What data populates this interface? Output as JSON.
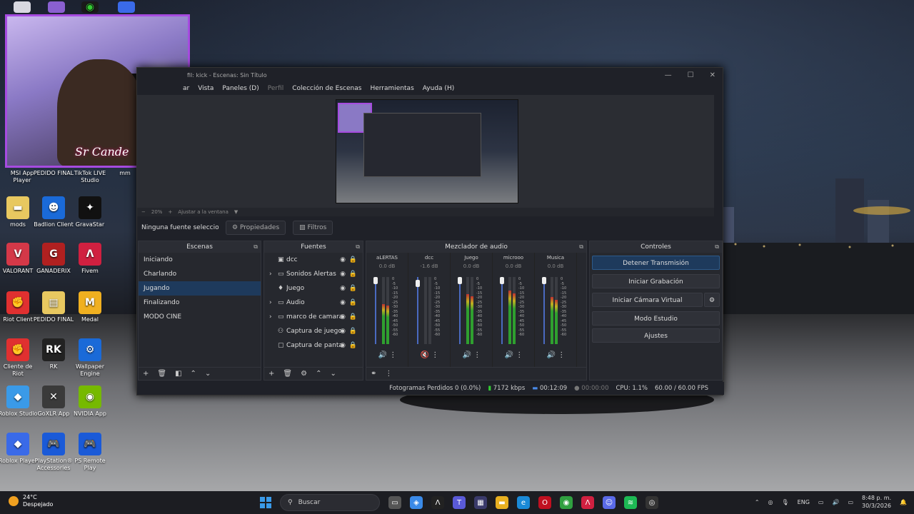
{
  "desktop_icons": [
    {
      "label": "MSI App Player",
      "color": "#2a6ad8",
      "glyph": "▶"
    },
    {
      "label": "PEDIDO FINAL",
      "color": "#e8c860",
      "glyph": "▤"
    },
    {
      "label": "TikTok LIVE Studio",
      "color": "#111111",
      "glyph": "♪"
    },
    {
      "label": "mm",
      "color": "#222222",
      "glyph": ""
    },
    {
      "label": "mods",
      "color": "#e8c860",
      "glyph": "▬"
    },
    {
      "label": "Badlion Client",
      "color": "#1a6ad8",
      "glyph": "☻"
    },
    {
      "label": "GravaStar",
      "color": "#111111",
      "glyph": "✦"
    },
    {
      "label": "VALORANT",
      "color": "#d43848",
      "glyph": "V"
    },
    {
      "label": "GANADERIX",
      "color": "#b02020",
      "glyph": "G"
    },
    {
      "label": "Fivem",
      "color": "#d02040",
      "glyph": "Λ"
    },
    {
      "label": "Riot Client",
      "color": "#e03030",
      "glyph": "✊"
    },
    {
      "label": "PEDIDO FINAL",
      "color": "#e8c860",
      "glyph": "▤"
    },
    {
      "label": "Medal",
      "color": "#f0b020",
      "glyph": "M"
    },
    {
      "label": "Cliente de Riot",
      "color": "#e03030",
      "glyph": "✊"
    },
    {
      "label": "RK",
      "color": "#222222",
      "glyph": "RK"
    },
    {
      "label": "Wallpaper Engine",
      "color": "#1a6ad8",
      "glyph": "⚙"
    },
    {
      "label": "Roblox Studio",
      "color": "#3a9ae8",
      "glyph": "◆"
    },
    {
      "label": "GoXLR App",
      "color": "#3a3a3a",
      "glyph": "✕"
    },
    {
      "label": "NVIDIA App",
      "color": "#76b900",
      "glyph": "◉"
    },
    {
      "label": "Roblox Player",
      "color": "#3a6ae8",
      "glyph": "◆"
    },
    {
      "label": "PlayStation® Accessories",
      "color": "#1a5ad8",
      "glyph": "🎮"
    },
    {
      "label": "PS Remote Play",
      "color": "#1a5ad8",
      "glyph": "🎮"
    }
  ],
  "webcam": {
    "overlay_text": "Sr Cande"
  },
  "obs": {
    "title": "fil: kick - Escenas: Sin Título",
    "menu": [
      "ar",
      "Vista",
      "Paneles (D)",
      "Perfil",
      "Colección de Escenas",
      "Herramientas",
      "Ayuda (H)"
    ],
    "zoom": {
      "minus": "−",
      "value": "20%",
      "plus": "+",
      "fit": "Ajustar a la ventana"
    },
    "no_source": "Ninguna fuente seleccionada",
    "properties_btn": "Propiedades",
    "filters_btn": "Filtros",
    "scenes": {
      "title": "Escenas",
      "items": [
        "Iniciando",
        "Charlando",
        "Jugando",
        "Finalizando",
        "MODO CINE"
      ],
      "selected": "Jugando"
    },
    "sources": {
      "title": "Fuentes",
      "items": [
        {
          "label": "dcc",
          "icon": "▣",
          "expand": ""
        },
        {
          "label": "Sonidos Alertas",
          "icon": "▭",
          "expand": "›"
        },
        {
          "label": "Juego",
          "icon": "♦",
          "expand": ""
        },
        {
          "label": "Audio",
          "icon": "▭",
          "expand": "›"
        },
        {
          "label": "marco de camara",
          "icon": "▭",
          "expand": "›"
        },
        {
          "label": "Captura de juego",
          "icon": "⚇",
          "expand": ""
        },
        {
          "label": "Captura de pantalla",
          "icon": "▢",
          "expand": ""
        }
      ]
    },
    "mixer": {
      "title": "Mezclador de audio",
      "channels": [
        {
          "name": "aLERTAS",
          "db": "0.0 dB",
          "level": 0.6,
          "fader": 1.0,
          "muted": false
        },
        {
          "name": "dcc",
          "db": "-1.6 dB",
          "level": 0.0,
          "fader": 0.95,
          "muted": true
        },
        {
          "name": "Juego",
          "db": "0.0 dB",
          "level": 0.75,
          "fader": 1.0,
          "muted": false
        },
        {
          "name": "microoo",
          "db": "0.0 dB",
          "level": 0.8,
          "fader": 1.0,
          "muted": false
        },
        {
          "name": "Musica",
          "db": "0.0 dB",
          "level": 0.7,
          "fader": 1.0,
          "muted": false
        }
      ],
      "scale": [
        "0",
        "-5",
        "-10",
        "-15",
        "-20",
        "-25",
        "-30",
        "-35",
        "-40",
        "-45",
        "-50",
        "-55",
        "-60"
      ]
    },
    "controls": {
      "title": "Controles",
      "stop_stream": "Detener Transmisión",
      "start_record": "Iniciar Grabación",
      "start_vcam": "Iniciar Cámara Virtual",
      "studio_mode": "Modo Estudio",
      "settings": "Ajustes"
    },
    "status": {
      "dropped": "Fotogramas Perdidos 0 (0.0%)",
      "bitrate": "7172 kbps",
      "stream_time": "00:12:09",
      "rec_time": "00:00:00",
      "cpu": "CPU: 1.1%",
      "fps": "60.00 / 60.00 FPS"
    }
  },
  "taskbar": {
    "weather_temp": "24°C",
    "weather_desc": "Despejado",
    "search_placeholder": "Buscar",
    "lang": "ENG",
    "time": "8:48 p. m.",
    "date": "30/3/2026"
  }
}
